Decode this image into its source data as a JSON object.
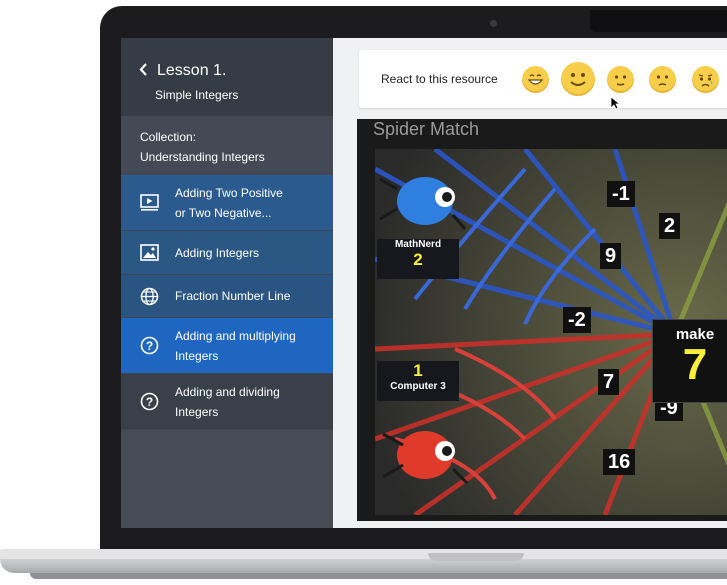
{
  "sidebar": {
    "lesson_title": "Lesson 1.",
    "lesson_subtitle": "Simple Integers",
    "collection_label": "Collection:",
    "collection_name": "Understanding Integers",
    "items": [
      {
        "label_line1": "Adding Two Positive",
        "label_line2": "or Two Negative...",
        "icon": "video-icon"
      },
      {
        "label_line1": "Adding Integers",
        "label_line2": "",
        "icon": "image-icon"
      },
      {
        "label_line1": "Fraction Number Line",
        "label_line2": "",
        "icon": "globe-icon"
      },
      {
        "label_line1": "Adding and multiplying",
        "label_line2": "Integers",
        "icon": "question-icon",
        "active": true
      },
      {
        "label_line1": "Adding and dividing",
        "label_line2": "Integers",
        "icon": "question-icon"
      }
    ]
  },
  "reactions": {
    "label": "React to this resource",
    "emojis": [
      "grinning-face-icon",
      "smiling-face-icon",
      "slight-smile-face-icon",
      "neutral-face-icon",
      "sad-face-icon"
    ]
  },
  "game": {
    "title": "Spider Match",
    "player1": {
      "name": "MathNerd",
      "score": "2"
    },
    "player2": {
      "name": "Computer 3",
      "score": "1"
    },
    "numbers": [
      "-1",
      "2",
      "9",
      "-2",
      "7",
      "-9",
      "16"
    ],
    "target_label": "make",
    "target_value": "7"
  },
  "colors": {
    "sidebar_bg": "#3f4650",
    "active_item": "#1f66c1",
    "item_bg": "#2a5a8e",
    "emoji": "#f7ce4a"
  }
}
